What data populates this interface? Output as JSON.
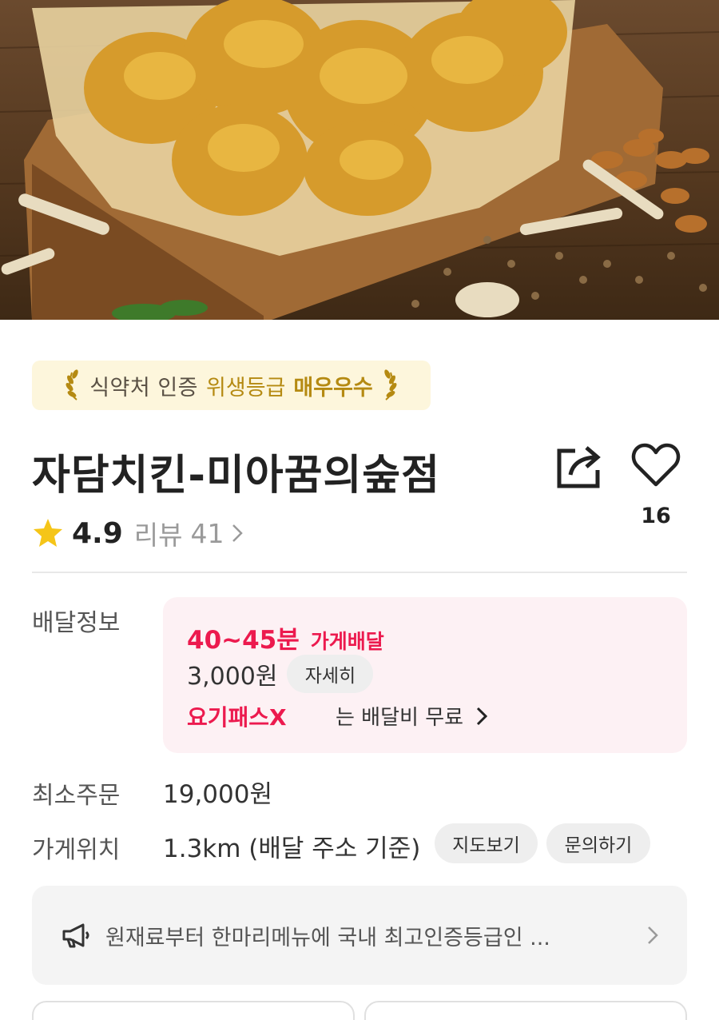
{
  "hero": {
    "image": "fried-chicken-photo"
  },
  "hygiene_badge": {
    "prefix": "식약처 인증",
    "grade_label": "위생등급",
    "grade": "매우우수",
    "icon": "laurel-wreath-icon"
  },
  "store": {
    "name": "자담치킨-미아꿈의숲점",
    "like_count": "16",
    "rating": "4.9",
    "review_label": "리뷰",
    "review_count": "41"
  },
  "delivery": {
    "label": "배달정보",
    "time": "40~45분",
    "type": "가게배달",
    "fee": "3,000원",
    "detail_button": "자세히",
    "pass_logo": "요기패스X",
    "pass_text": "는 배달비 무료"
  },
  "min_order": {
    "label": "최소주문",
    "value": "19,000원"
  },
  "location": {
    "label": "가게위치",
    "value": "1.3km (배달 주소 기준)",
    "map_button": "지도보기",
    "inquiry_button": "문의하기"
  },
  "notice": {
    "text": "원재료부터 한마리메뉴에 국내 최고인증등급인 ...",
    "icon": "megaphone-icon"
  },
  "colors": {
    "accent": "#ec1a4e",
    "badge_bg": "#fdf6dc",
    "badge_gold": "#b58a12",
    "delivery_bg": "#fdf1f4",
    "star": "#f5c518"
  }
}
